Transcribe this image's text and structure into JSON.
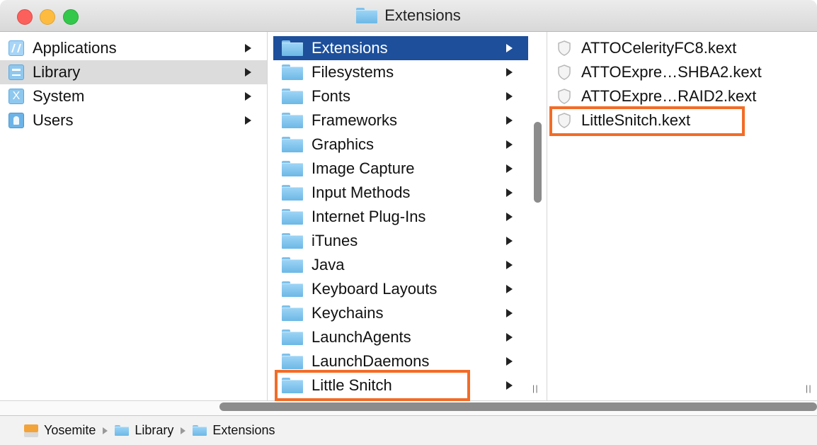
{
  "window": {
    "title": "Extensions"
  },
  "column1": {
    "items": [
      {
        "label": "Applications",
        "icon": "applications-icon",
        "selected": false
      },
      {
        "label": "Library",
        "icon": "library-icon",
        "selected": true
      },
      {
        "label": "System",
        "icon": "system-icon",
        "selected": false
      },
      {
        "label": "Users",
        "icon": "users-icon",
        "selected": false
      }
    ]
  },
  "column2": {
    "items": [
      {
        "label": "Extensions",
        "selected": true
      },
      {
        "label": "Filesystems"
      },
      {
        "label": "Fonts"
      },
      {
        "label": "Frameworks"
      },
      {
        "label": "Graphics"
      },
      {
        "label": "Image Capture"
      },
      {
        "label": "Input Methods"
      },
      {
        "label": "Internet Plug-Ins"
      },
      {
        "label": "iTunes"
      },
      {
        "label": "Java"
      },
      {
        "label": "Keyboard Layouts"
      },
      {
        "label": "Keychains"
      },
      {
        "label": "LaunchAgents"
      },
      {
        "label": "LaunchDaemons"
      },
      {
        "label": "Little Snitch"
      }
    ]
  },
  "column3": {
    "items": [
      {
        "label": "ATTOCelerityFC8.kext"
      },
      {
        "label": "ATTOExpre…SHBA2.kext"
      },
      {
        "label": "ATTOExpre…RAID2.kext"
      },
      {
        "label": "LittleSnitch.kext"
      }
    ]
  },
  "pathbar": {
    "segments": [
      "Yosemite",
      "Library",
      "Extensions"
    ]
  },
  "colors": {
    "selection": "#1d4f9b",
    "highlight": "#f26c27",
    "folder": "#6cb8e6"
  }
}
